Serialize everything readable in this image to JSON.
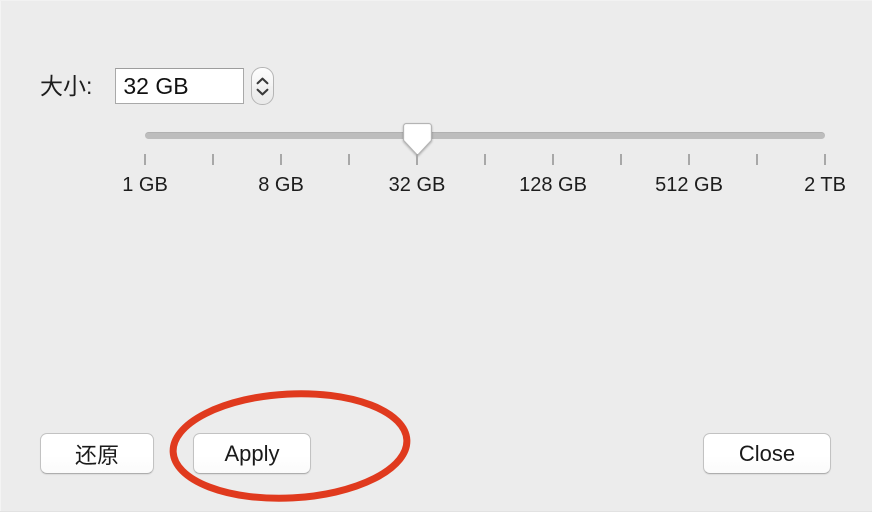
{
  "window": {
    "background_color": "#ECECEC"
  },
  "size_row": {
    "label": "大小:",
    "field": {
      "value": "32 GB",
      "placeholder": "32 GB"
    },
    "stepper": {
      "increment_icon": "chevron-up-icon",
      "decrement_icon": "chevron-down-icon"
    }
  },
  "slider": {
    "value": "32 GB",
    "value_index": 4,
    "min_label": "1 GB",
    "max_label": "2 TB",
    "thumb_position_percent": 40,
    "track_color": "#BDBDBD",
    "tick_count": 11,
    "tick_positions_percent": [
      0,
      10,
      20,
      30,
      40,
      50,
      60,
      70,
      80,
      90,
      100
    ],
    "labeled_ticks": [
      {
        "label": "1 GB",
        "position_percent": 0
      },
      {
        "label": "8 GB",
        "position_percent": 20
      },
      {
        "label": "32 GB",
        "position_percent": 40
      },
      {
        "label": "128 GB",
        "position_percent": 60
      },
      {
        "label": "512 GB",
        "position_percent": 80
      },
      {
        "label": "2 TB",
        "position_percent": 100
      }
    ]
  },
  "buttons": {
    "revert": "还原",
    "apply": "Apply",
    "close": "Close"
  },
  "annotation": {
    "shape": "ellipse",
    "color": "#E03A1E",
    "stroke_width": 7,
    "target": "Apply"
  }
}
